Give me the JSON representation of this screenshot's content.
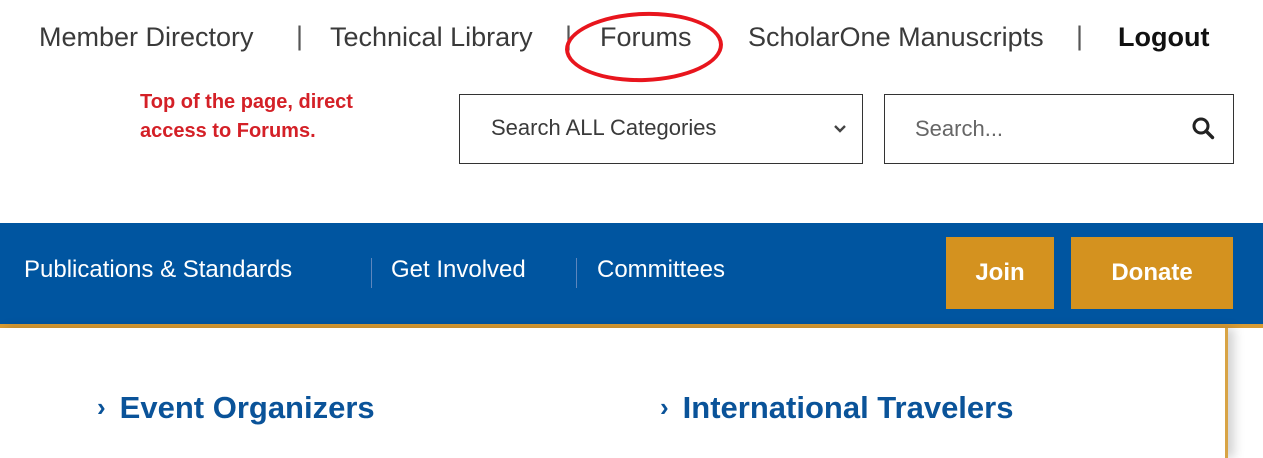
{
  "top_links": {
    "member_directory": "Member Directory",
    "technical_library": "Technical Library",
    "forums": "Forums",
    "scholarone": "ScholarOne Manuscripts",
    "logout": "Logout",
    "separator": "|"
  },
  "annotation": {
    "line1": "Top of the page, direct",
    "line2": "access to Forums."
  },
  "search": {
    "category_selected": "Search ALL Categories",
    "placeholder": "Search..."
  },
  "nav": {
    "items": [
      "Publications & Standards",
      "Get Involved",
      "Committees"
    ],
    "join_label": "Join",
    "donate_label": "Donate"
  },
  "content": {
    "links": [
      "Event Organizers",
      "International Travelers"
    ],
    "arrow": "›"
  },
  "colors": {
    "nav_bg": "#0055a0",
    "button_bg": "#d4921f",
    "accent_line": "#d89b33",
    "annotation": "#d42027",
    "link_blue": "#0a5399"
  },
  "icons": {
    "select_chevron": "chevron-down-icon",
    "search": "search-icon"
  }
}
